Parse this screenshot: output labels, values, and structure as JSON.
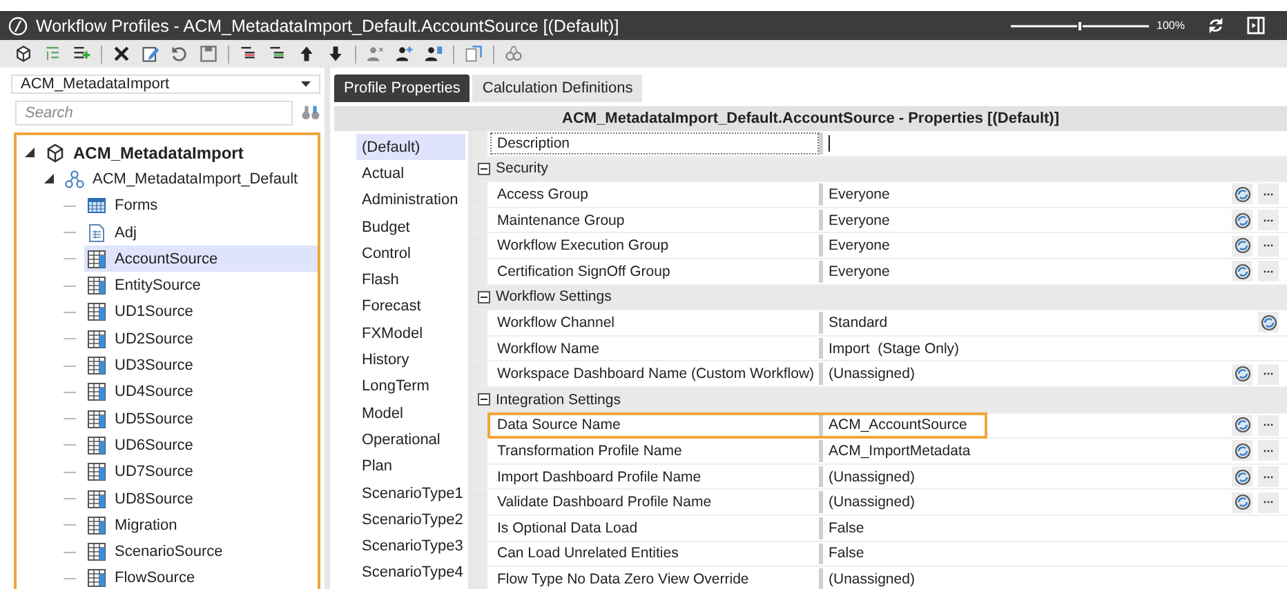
{
  "window": {
    "title": "Workflow Profiles - ACM_MetadataImport_Default.AccountSource [(Default)]",
    "zoom": "100%",
    "zoom_slider": {
      "level": 0.5
    }
  },
  "toolbar": [
    {
      "kind": "cube"
    },
    {
      "kind": "add-child"
    },
    {
      "kind": "add-sibling"
    },
    {
      "kind": "sep"
    },
    {
      "kind": "delete"
    },
    {
      "kind": "rename"
    },
    {
      "kind": "revert"
    },
    {
      "kind": "save"
    },
    {
      "kind": "sep"
    },
    {
      "kind": "collapse"
    },
    {
      "kind": "expand"
    },
    {
      "kind": "up"
    },
    {
      "kind": "down"
    },
    {
      "kind": "sep"
    },
    {
      "kind": "user-remove"
    },
    {
      "kind": "user-add"
    },
    {
      "kind": "user-list"
    },
    {
      "kind": "sep"
    },
    {
      "kind": "copy"
    },
    {
      "kind": "sep"
    },
    {
      "kind": "find"
    }
  ],
  "profile_dropdown": {
    "value": "ACM_MetadataImport"
  },
  "search": {
    "placeholder": "Search"
  },
  "tree": {
    "highlighted": true,
    "items": [
      {
        "label": "ACM_MetadataImport",
        "kind": "cube",
        "selected": false,
        "expanded": true,
        "children": [
          {
            "label": "ACM_MetadataImport_Default",
            "kind": "workflow",
            "selected": false,
            "expanded": true,
            "children": [
              {
                "label": "Forms",
                "kind": "forms",
                "selected": false
              },
              {
                "label": "Adj",
                "kind": "adj",
                "selected": false
              },
              {
                "label": "AccountSource",
                "kind": "source",
                "selected": true
              },
              {
                "label": "EntitySource",
                "kind": "source",
                "selected": false
              },
              {
                "label": "UD1Source",
                "kind": "source",
                "selected": false
              },
              {
                "label": "UD2Source",
                "kind": "source",
                "selected": false
              },
              {
                "label": "UD3Source",
                "kind": "source",
                "selected": false
              },
              {
                "label": "UD4Source",
                "kind": "source",
                "selected": false
              },
              {
                "label": "UD5Source",
                "kind": "source",
                "selected": false
              },
              {
                "label": "UD6Source",
                "kind": "source",
                "selected": false
              },
              {
                "label": "UD7Source",
                "kind": "source",
                "selected": false
              },
              {
                "label": "UD8Source",
                "kind": "source",
                "selected": false
              },
              {
                "label": "Migration",
                "kind": "source",
                "selected": false
              },
              {
                "label": "ScenarioSource",
                "kind": "source",
                "selected": false
              },
              {
                "label": "FlowSource",
                "kind": "source",
                "selected": false
              }
            ]
          }
        ]
      }
    ]
  },
  "tabs": [
    {
      "label": "Profile Properties",
      "selected": true
    },
    {
      "label": "Calculation Definitions",
      "selected": false
    }
  ],
  "properties_header": "ACM_MetadataImport_Default.AccountSource - Properties  [(Default)]",
  "scenario_types": [
    {
      "label": "(Default)",
      "selected": true
    },
    {
      "label": "Actual",
      "selected": false
    },
    {
      "label": "Administration",
      "selected": false
    },
    {
      "label": "Budget",
      "selected": false
    },
    {
      "label": "Control",
      "selected": false
    },
    {
      "label": "Flash",
      "selected": false
    },
    {
      "label": "Forecast",
      "selected": false
    },
    {
      "label": "FXModel",
      "selected": false
    },
    {
      "label": "History",
      "selected": false
    },
    {
      "label": "LongTerm",
      "selected": false
    },
    {
      "label": "Model",
      "selected": false
    },
    {
      "label": "Operational",
      "selected": false
    },
    {
      "label": "Plan",
      "selected": false
    },
    {
      "label": "ScenarioType1",
      "selected": false
    },
    {
      "label": "ScenarioType2",
      "selected": false
    },
    {
      "label": "ScenarioType3",
      "selected": false
    },
    {
      "label": "ScenarioType4",
      "selected": false
    }
  ],
  "properties": [
    {
      "kind": "property",
      "name": "Description",
      "focused": true,
      "editing": true,
      "picker": false,
      "more": false,
      "highlighted": false
    },
    {
      "kind": "group",
      "name": "Security",
      "expanded": true
    },
    {
      "kind": "property",
      "name": "Access Group",
      "value": "Everyone",
      "picker": true,
      "more": true,
      "highlighted": false
    },
    {
      "kind": "property",
      "name": "Maintenance Group",
      "value": "Everyone",
      "picker": true,
      "more": true,
      "highlighted": false
    },
    {
      "kind": "property",
      "name": "Workflow Execution Group",
      "value": "Everyone",
      "picker": true,
      "more": true,
      "highlighted": false
    },
    {
      "kind": "property",
      "name": "Certification SignOff Group",
      "value": "Everyone",
      "picker": true,
      "more": true,
      "highlighted": false
    },
    {
      "kind": "group",
      "name": "Workflow Settings",
      "expanded": true
    },
    {
      "kind": "property",
      "name": "Workflow Channel",
      "value": "Standard",
      "picker": true,
      "more": false,
      "highlighted": false
    },
    {
      "kind": "property",
      "name": "Workflow Name",
      "value": "Import  (Stage Only)",
      "picker": false,
      "more": false,
      "highlighted": false
    },
    {
      "kind": "property",
      "name": "Workspace Dashboard Name (Custom Workflow)",
      "value": "(Unassigned)",
      "picker": true,
      "more": true,
      "highlighted": false
    },
    {
      "kind": "group",
      "name": "Integration Settings",
      "expanded": true
    },
    {
      "kind": "property",
      "name": "Data Source Name",
      "value": "ACM_AccountSource",
      "picker": true,
      "more": true,
      "highlighted": true
    },
    {
      "kind": "property",
      "name": "Transformation Profile Name",
      "value": "ACM_ImportMetadata",
      "picker": true,
      "more": true,
      "highlighted": false
    },
    {
      "kind": "property",
      "name": "Import Dashboard Profile Name",
      "value": "(Unassigned)",
      "picker": true,
      "more": true,
      "highlighted": false
    },
    {
      "kind": "property",
      "name": "Validate Dashboard Profile Name",
      "value": "(Unassigned)",
      "picker": true,
      "more": true,
      "highlighted": false
    },
    {
      "kind": "property",
      "name": "Is Optional Data Load",
      "value": "False",
      "picker": false,
      "more": false,
      "highlighted": false
    },
    {
      "kind": "property",
      "name": "Can Load Unrelated Entities",
      "value": "False",
      "picker": false,
      "more": false,
      "highlighted": false
    },
    {
      "kind": "property",
      "name": "Flow Type No Data Zero View Override",
      "value": "(Unassigned)",
      "picker": false,
      "more": false,
      "highlighted": false
    }
  ]
}
